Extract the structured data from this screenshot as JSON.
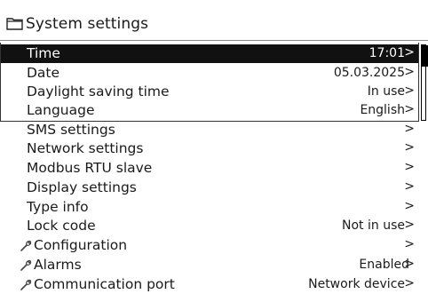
{
  "header": {
    "title": "System settings",
    "icon": "folder-icon"
  },
  "menu": [
    {
      "label": "Time",
      "value": "17:01",
      "chevron": ">"
    },
    {
      "label": "Date",
      "value": "05.03.2025",
      "chevron": ">"
    },
    {
      "label": "Daylight saving time",
      "value": "In use",
      "chevron": ">"
    },
    {
      "label": "Language",
      "value": "English",
      "chevron": ">"
    },
    {
      "label": "SMS settings",
      "value": "",
      "chevron": ">"
    },
    {
      "label": "Network settings",
      "value": "",
      "chevron": ">"
    },
    {
      "label": "Modbus RTU slave",
      "value": "",
      "chevron": ">"
    },
    {
      "label": "Display settings",
      "value": "",
      "chevron": ">"
    },
    {
      "label": "Type info",
      "value": "",
      "chevron": ">"
    },
    {
      "label": "Lock code",
      "value": "Not in use",
      "chevron": ">"
    },
    {
      "label": "Configuration",
      "value": "",
      "chevron": ">",
      "icon": "wrench-icon"
    },
    {
      "label": "Alarms",
      "value": "Enabled",
      "chevron": ">",
      "icon": "wrench-icon"
    },
    {
      "label": "Communication port",
      "value": "Network device",
      "chevron": ">",
      "icon": "wrench-icon"
    }
  ],
  "selected_index": 0,
  "colors": {
    "selected_bg": "#111111",
    "selected_fg": "#ffffff",
    "text": "#1a1a1a"
  }
}
